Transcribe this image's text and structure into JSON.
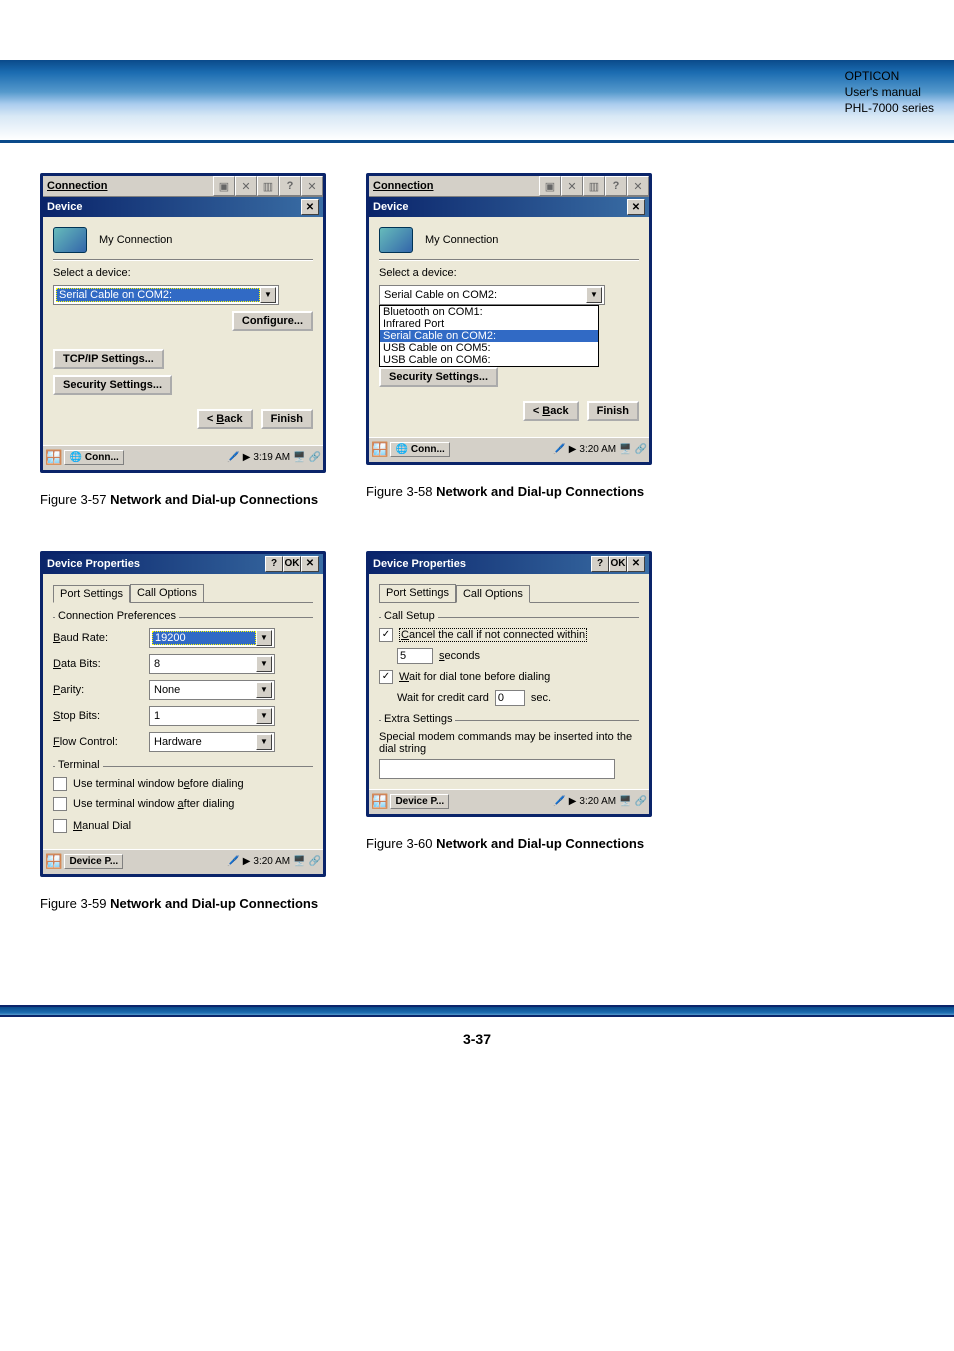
{
  "header": {
    "line1": "OPTICON",
    "line2": "User's manual",
    "line3": "PHL-7000 series"
  },
  "page_number": "3-37",
  "shots": {
    "s57": {
      "title": "Connection",
      "device_bar": "Device",
      "myconn": "My Connection",
      "select_device": "Select a device:",
      "combo_value": "Serial Cable on COM2:",
      "configure": "Configure...",
      "tcpip": "TCP/IP Settings...",
      "security": "Security Settings...",
      "back": "< Back",
      "finish": "Finish",
      "tb_app": "Conn...",
      "tb_time": "3:19 AM",
      "caption_prefix": "Figure 3-57 ",
      "caption_bold": "Network and Dial-up Connections"
    },
    "s58": {
      "title": "Connection",
      "device_bar": "Device",
      "myconn": "My Connection",
      "select_device": "Select a device:",
      "combo_value": "Serial Cable on COM2:",
      "options": [
        "Bluetooth on COM1:",
        "Infrared Port",
        "Serial Cable on COM2:",
        "USB Cable on COM5:",
        "USB Cable on COM6:"
      ],
      "security": "Security Settings...",
      "back": "< Back",
      "finish": "Finish",
      "tb_app": "Conn...",
      "tb_time": "3:20 AM",
      "caption_prefix": "Figure 3-58 ",
      "caption_bold": "Network and Dial-up Connections"
    },
    "s59": {
      "title": "Device Properties",
      "tab1": "Port Settings",
      "tab2": "Call Options",
      "group1": "Connection Preferences",
      "baud_label": "Baud Rate:",
      "baud": "19200",
      "databits_label": "Data Bits:",
      "databits": "8",
      "parity_label": "Parity:",
      "parity": "None",
      "stopbits_label": "Stop Bits:",
      "stopbits": "1",
      "flow_label": "Flow Control:",
      "flow": "Hardware",
      "group2": "Terminal",
      "ck1": "Use terminal window before dialing",
      "ck2": "Use terminal window after dialing",
      "ck3": "Manual Dial",
      "tb_app": "Device P...",
      "tb_time": "3:20 AM",
      "caption_prefix": "Figure 3-59 ",
      "caption_bold": "Network and Dial-up Connections"
    },
    "s60": {
      "title": "Device Properties",
      "tab1": "Port Settings",
      "tab2": "Call Options",
      "group1": "Call Setup",
      "ck1": "Cancel the call if not connected within",
      "sec_value": "5",
      "sec_label": "seconds",
      "ck2": "Wait for dial tone before dialing",
      "wait_credit": "Wait for credit card",
      "wait_value": "0",
      "wait_unit": "sec.",
      "group2": "Extra Settings",
      "extra_text": "Special modem commands may be inserted into the dial string",
      "extra_value": "",
      "tb_app": "Device P...",
      "tb_time": "3:20 AM",
      "caption_prefix": "Figure 3-60 ",
      "caption_bold": "Network and Dial-up Connections"
    }
  }
}
